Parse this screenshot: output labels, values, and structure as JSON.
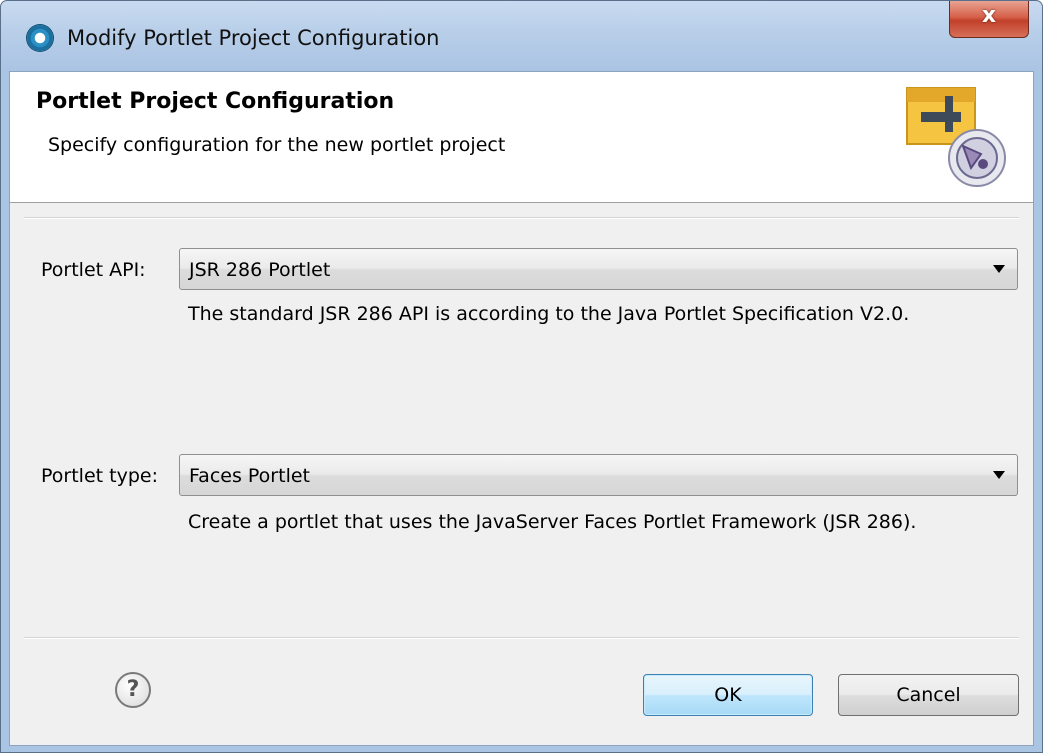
{
  "window": {
    "title": "Modify Portlet Project Configuration",
    "close_label": "x"
  },
  "header": {
    "title": "Portlet Project Configuration",
    "description": "Specify configuration for the new portlet project"
  },
  "fields": {
    "api": {
      "label": "Portlet API:",
      "value": "JSR 286 Portlet",
      "description": "The standard JSR 286 API is according to the Java Portlet Specification V2.0."
    },
    "type": {
      "label": "Portlet type:",
      "value": "Faces Portlet",
      "description": "Create a portlet that uses the JavaServer Faces Portlet Framework (JSR 286)."
    }
  },
  "footer": {
    "help_symbol": "?",
    "ok_label": "OK",
    "cancel_label": "Cancel"
  },
  "colors": {
    "title_bar": "#b9cfe9",
    "close_button": "#c2402a",
    "dialog_background": "#f0f0f0",
    "header_background": "#ffffff",
    "default_button": "#bee6fd"
  }
}
